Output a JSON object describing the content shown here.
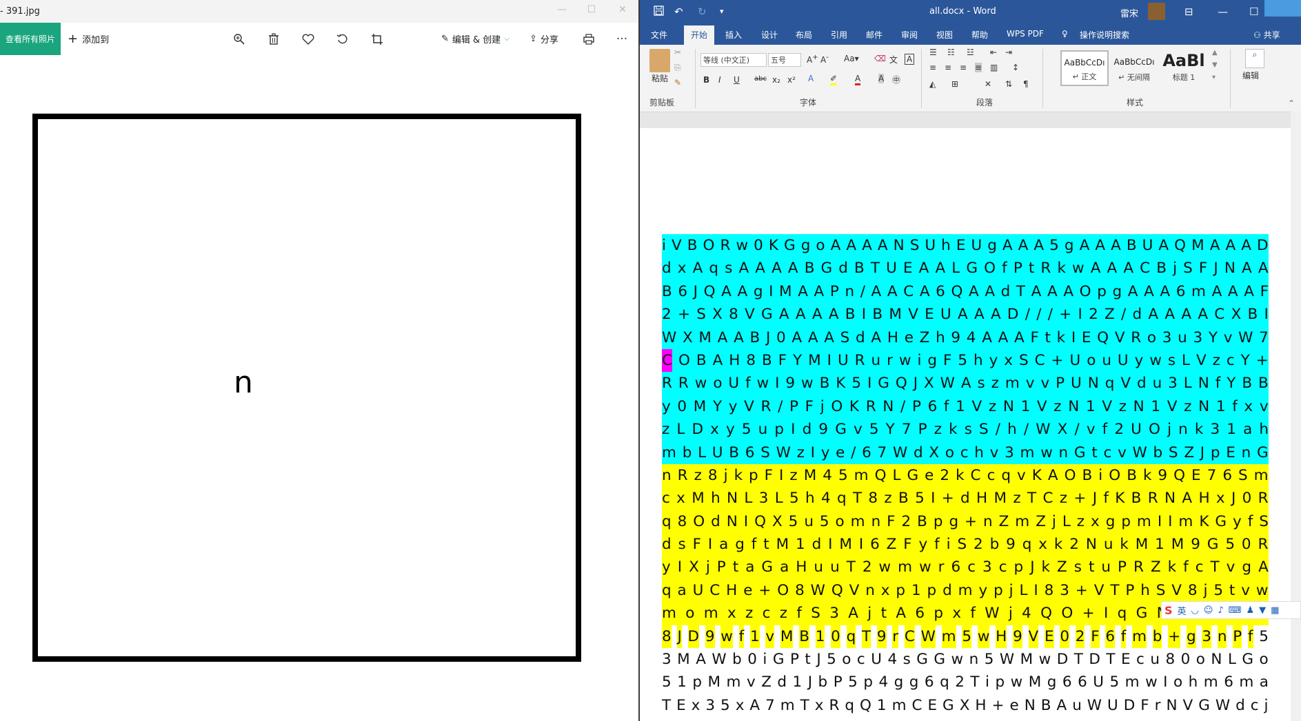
{
  "photos": {
    "title": "- 391.jpg",
    "toolbar": {
      "view_all": "查看所有照片",
      "add_to": "添加到",
      "edit_create": "编辑 & 创建",
      "share": "分享",
      "more": "···"
    },
    "image_letter": "n"
  },
  "word": {
    "title": "all.docx - Word",
    "user": "雷宋",
    "tabs": [
      "文件",
      "开始",
      "插入",
      "设计",
      "布局",
      "引用",
      "邮件",
      "审阅",
      "视图",
      "帮助",
      "WPS PDF"
    ],
    "active_tab": "开始",
    "tell_me": "操作说明搜索",
    "share": "共享",
    "ribbon": {
      "paste": "粘贴",
      "clipboard": "剪贴板",
      "font_name": "等线 (中文正)",
      "font_size": "五号",
      "font_group": "字体",
      "paragraph_group": "段落",
      "styles_group": "样式",
      "edit": "编辑",
      "styles": [
        {
          "sample": "AaBbCcDı",
          "name": "↵ 正文"
        },
        {
          "sample": "AaBbCcDı",
          "name": "↵ 无间隔"
        },
        {
          "sample": "AaBl",
          "name": "标题 1"
        }
      ]
    },
    "lines": [
      {
        "text": "iVBORw0KGgoAAAANSUhEUgAAA5gAAABUAQMAAAD",
        "hl": "cyan"
      },
      {
        "text": "dxAqsAAAABGdBTUEAALGOfPtRkwAAACBjSFJNAA",
        "hl": "cyan"
      },
      {
        "text": "B6JQAAgIMAAPn/AACA6QAAdTAAAOpgAAA6mAAAF",
        "hl": "cyan"
      },
      {
        "text": "2+SX8VGAAAABIBMVEUAAAD///+I2Z/dAAAACXBI",
        "hl": "cyan"
      },
      {
        "text": "WXMAABJ0AAASdAHeZh94AAAFtkIEQVRo3u3YvW7",
        "hl": "cyan"
      },
      {
        "text": "COBAH8BFYMIURurwigF5hyxSC+UouUywsLVzcY+",
        "hl": "cyan",
        "magenta_first": true
      },
      {
        "text": "RRwoUfwI9wBK5IGQJXWAszmvvPUNqVdu3LNfYBB",
        "hl": "cyan"
      },
      {
        "text": "y0MYyVR/PFjOKRN/P6f1VzN1VzN1VzN1VzN1fxv",
        "hl": "cyan"
      },
      {
        "text": "zLDxy5upId9Gv5Y7PzksS/h/WX/vf2UOjnk31ah",
        "hl": "cyan"
      },
      {
        "text": "mbLUB6SWzIye/67WdXochv3mwnGtcvWbSZJpEnG",
        "hl": "cyan"
      },
      {
        "text": "nRz8jkpFIzM45mQLGe2kCcqvKAOBiOBk9QE76Sm",
        "hl": "yellow"
      },
      {
        "text": "cxMhNL3L5h4qT8zB5I+dHMzTCz+JfKBRNAHxJ0R",
        "hl": "yellow"
      },
      {
        "text": "q8OdNIQX5u5omnF2Bpg+nZmZjLzxgpmIImKGyfS",
        "hl": "yellow"
      },
      {
        "text": "dsFIagftM1dIMI6ZFyfiS2b9qxk2NukM1M9G50R",
        "hl": "yellow"
      },
      {
        "text": "yIXjPtaGaHuuT2wmwr6c3cpJkZstuPRZkfcTvgA",
        "hl": "yellow"
      },
      {
        "text": "qaUCHe+O8WQVnxp1pdmypjLI83+VTPhSV8j5tvw",
        "hl": "yellow"
      },
      {
        "text": "momxzczfS3AjtA6pxfWj4QO+IqGMHA7MS",
        "hl": "yellow"
      },
      {
        "text": "8JD9wf1vMB10qT9rCWm5wH9VE02F6fmb+g3nPf5",
        "hl": "yellow",
        "yellow_len": 38
      },
      {
        "text": "3MAWb0iGPtJ5ocU4sGGwn5WMwDTDTEcu80oNLGo",
        "hl": "none"
      },
      {
        "text": "51pMmvZd1JbP5p4gg6q2TipwMg66U5mwIohm6ma",
        "hl": "none"
      },
      {
        "text": "TEx35xA7mTxRqQ1mCEGXH+eNBAuWUDFrNVGWdcj",
        "hl": "none"
      }
    ],
    "ime": "英"
  },
  "colors": {
    "photos_accent": "#1aa57e",
    "word_blue": "#2b579a",
    "highlight_cyan": "#00ffff",
    "highlight_yellow": "#ffff00",
    "highlight_magenta": "#ff00ff"
  }
}
